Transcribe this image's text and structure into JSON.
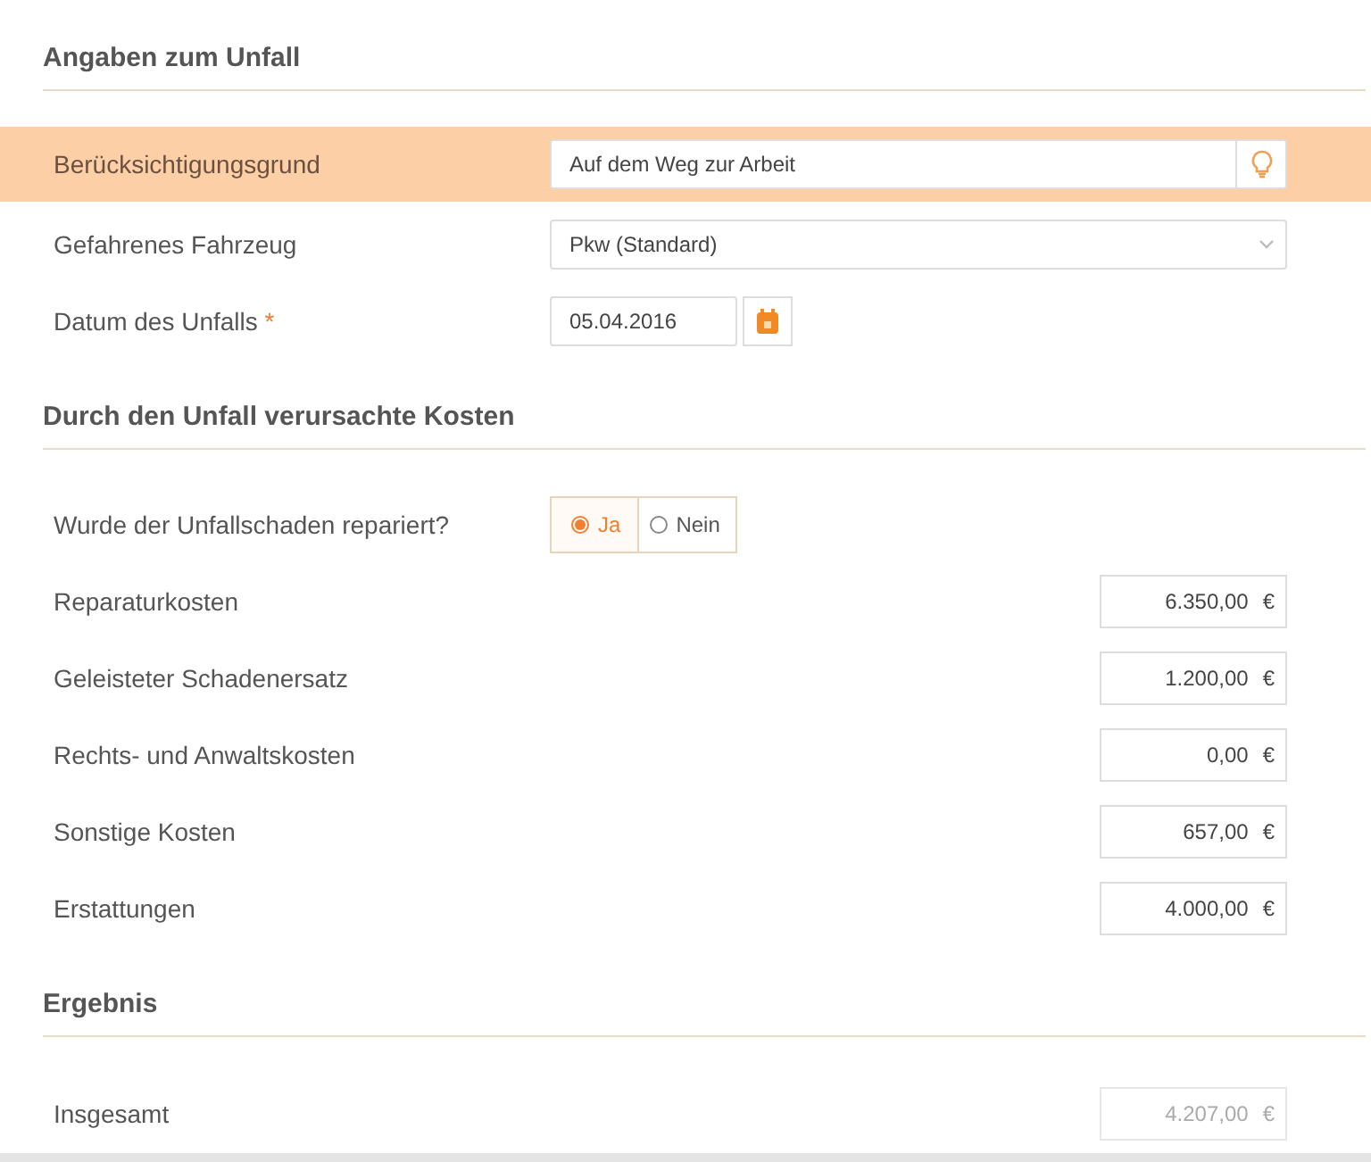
{
  "sections": [
    {
      "title": "Angaben zum Unfall",
      "rows": [
        {
          "kind": "hint-field",
          "label": "Berücksichtigungsgrund",
          "value": "Auf dem Weg zur Arbeit",
          "highlighted": true
        },
        {
          "kind": "dropdown",
          "label": "Gefahrenes Fahrzeug",
          "value": "Pkw (Standard)",
          "highlighted": false
        },
        {
          "kind": "date",
          "label": "Datum des Unfalls",
          "required": true,
          "required_mark": "*",
          "value": "05.04.2016",
          "highlighted": false
        }
      ]
    },
    {
      "title": "Durch den Unfall verursachte Kosten",
      "rows": [
        {
          "kind": "radio",
          "label": "Wurde der Unfallschaden repariert?",
          "options": [
            {
              "label": "Ja",
              "selected": true
            },
            {
              "label": "Nein",
              "selected": false
            }
          ]
        },
        {
          "kind": "amount",
          "label": "Reparaturkosten",
          "value": "6.350,00",
          "currency": "€",
          "disabled": false
        },
        {
          "kind": "amount",
          "label": "Geleisteter Schadenersatz",
          "value": "1.200,00",
          "currency": "€",
          "disabled": false
        },
        {
          "kind": "amount",
          "label": "Rechts- und Anwaltskosten",
          "value": "0,00",
          "currency": "€",
          "disabled": false
        },
        {
          "kind": "amount",
          "label": "Sonstige Kosten",
          "value": "657,00",
          "currency": "€",
          "disabled": false
        },
        {
          "kind": "amount",
          "label": "Erstattungen",
          "value": "4.000,00",
          "currency": "€",
          "disabled": false
        }
      ]
    },
    {
      "title": "Ergebnis",
      "rows": [
        {
          "kind": "amount",
          "label": "Insgesamt",
          "value": "4.207,00",
          "currency": "€",
          "disabled": true
        }
      ]
    }
  ]
}
